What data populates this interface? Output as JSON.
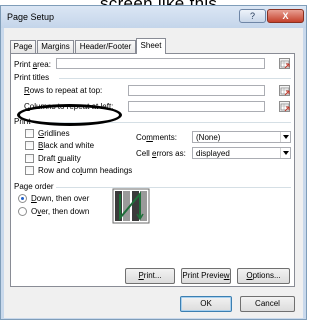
{
  "caption": "screen like this",
  "window": {
    "title": "Page Setup",
    "help_label": "?",
    "close_label": "X"
  },
  "tabs": [
    {
      "label": "Page",
      "active": false
    },
    {
      "label": "Margins",
      "active": false
    },
    {
      "label": "Header/Footer",
      "active": false
    },
    {
      "label": "Sheet",
      "active": true
    }
  ],
  "print_area": {
    "pre": "Print ",
    "key": "a",
    "post": "rea:",
    "value": ""
  },
  "print_titles": {
    "header": "Print titles",
    "rows_to_repeat": {
      "pre": "",
      "key": "R",
      "post": "ows to repeat at top:",
      "value": ""
    },
    "columns_to_repeat": {
      "pre": "",
      "key": "C",
      "post": "olumns to repeat at left:",
      "value": ""
    }
  },
  "print_section": {
    "header": "Print",
    "gridlines": {
      "pre": "",
      "key": "G",
      "post": "ridlines",
      "checked": false
    },
    "black_and_white": {
      "pre": "",
      "key": "B",
      "post": "lack and white",
      "checked": false
    },
    "draft_quality": {
      "pre": "Draft ",
      "key": "q",
      "post": "uality",
      "checked": false
    },
    "row_col_headings": {
      "pre": "Row and co",
      "key": "l",
      "post": "umn headings",
      "checked": false
    },
    "comments": {
      "pre": "Co",
      "key": "m",
      "post": "ments:",
      "value": "(None)"
    },
    "cell_errors": {
      "pre": "Cell ",
      "key": "e",
      "post": "rrors as:",
      "value": "displayed"
    }
  },
  "page_order": {
    "header": "Page order",
    "down_then_over": {
      "pre": "",
      "key": "D",
      "post": "own, then over",
      "selected": true
    },
    "over_then_down": {
      "pre": "O",
      "key": "v",
      "post": "er, then down",
      "selected": false
    }
  },
  "buttons": {
    "print": {
      "pre": "",
      "key": "P",
      "post": "rint..."
    },
    "print_preview": {
      "pre": "Print Previe",
      "key": "w",
      "post": ""
    },
    "options": {
      "pre": "",
      "key": "O",
      "post": "ptions..."
    },
    "ok": "OK",
    "cancel": "Cancel"
  },
  "icons": {
    "range_picker": "range-picker-icon",
    "page_order_preview": "page-order-preview-icon"
  },
  "colors": {
    "title_bar": "#c4d5ea",
    "close_button": "#c4412c",
    "picker_arrow": "#c0392b",
    "order_arrow": "#1f6f3a"
  }
}
